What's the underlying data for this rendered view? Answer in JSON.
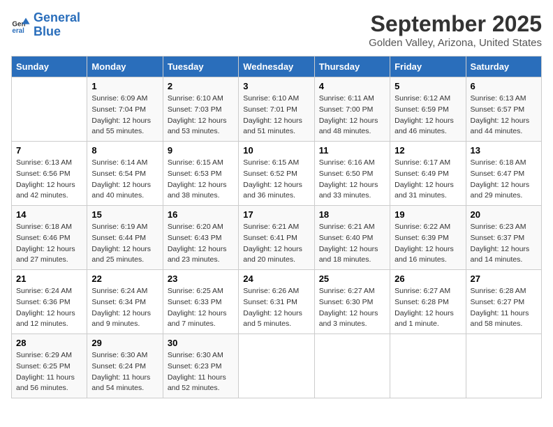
{
  "logo": {
    "line1": "General",
    "line2": "Blue"
  },
  "title": "September 2025",
  "location": "Golden Valley, Arizona, United States",
  "days_of_week": [
    "Sunday",
    "Monday",
    "Tuesday",
    "Wednesday",
    "Thursday",
    "Friday",
    "Saturday"
  ],
  "weeks": [
    [
      {
        "day": "",
        "info": ""
      },
      {
        "day": "1",
        "info": "Sunrise: 6:09 AM\nSunset: 7:04 PM\nDaylight: 12 hours\nand 55 minutes."
      },
      {
        "day": "2",
        "info": "Sunrise: 6:10 AM\nSunset: 7:03 PM\nDaylight: 12 hours\nand 53 minutes."
      },
      {
        "day": "3",
        "info": "Sunrise: 6:10 AM\nSunset: 7:01 PM\nDaylight: 12 hours\nand 51 minutes."
      },
      {
        "day": "4",
        "info": "Sunrise: 6:11 AM\nSunset: 7:00 PM\nDaylight: 12 hours\nand 48 minutes."
      },
      {
        "day": "5",
        "info": "Sunrise: 6:12 AM\nSunset: 6:59 PM\nDaylight: 12 hours\nand 46 minutes."
      },
      {
        "day": "6",
        "info": "Sunrise: 6:13 AM\nSunset: 6:57 PM\nDaylight: 12 hours\nand 44 minutes."
      }
    ],
    [
      {
        "day": "7",
        "info": "Sunrise: 6:13 AM\nSunset: 6:56 PM\nDaylight: 12 hours\nand 42 minutes."
      },
      {
        "day": "8",
        "info": "Sunrise: 6:14 AM\nSunset: 6:54 PM\nDaylight: 12 hours\nand 40 minutes."
      },
      {
        "day": "9",
        "info": "Sunrise: 6:15 AM\nSunset: 6:53 PM\nDaylight: 12 hours\nand 38 minutes."
      },
      {
        "day": "10",
        "info": "Sunrise: 6:15 AM\nSunset: 6:52 PM\nDaylight: 12 hours\nand 36 minutes."
      },
      {
        "day": "11",
        "info": "Sunrise: 6:16 AM\nSunset: 6:50 PM\nDaylight: 12 hours\nand 33 minutes."
      },
      {
        "day": "12",
        "info": "Sunrise: 6:17 AM\nSunset: 6:49 PM\nDaylight: 12 hours\nand 31 minutes."
      },
      {
        "day": "13",
        "info": "Sunrise: 6:18 AM\nSunset: 6:47 PM\nDaylight: 12 hours\nand 29 minutes."
      }
    ],
    [
      {
        "day": "14",
        "info": "Sunrise: 6:18 AM\nSunset: 6:46 PM\nDaylight: 12 hours\nand 27 minutes."
      },
      {
        "day": "15",
        "info": "Sunrise: 6:19 AM\nSunset: 6:44 PM\nDaylight: 12 hours\nand 25 minutes."
      },
      {
        "day": "16",
        "info": "Sunrise: 6:20 AM\nSunset: 6:43 PM\nDaylight: 12 hours\nand 23 minutes."
      },
      {
        "day": "17",
        "info": "Sunrise: 6:21 AM\nSunset: 6:41 PM\nDaylight: 12 hours\nand 20 minutes."
      },
      {
        "day": "18",
        "info": "Sunrise: 6:21 AM\nSunset: 6:40 PM\nDaylight: 12 hours\nand 18 minutes."
      },
      {
        "day": "19",
        "info": "Sunrise: 6:22 AM\nSunset: 6:39 PM\nDaylight: 12 hours\nand 16 minutes."
      },
      {
        "day": "20",
        "info": "Sunrise: 6:23 AM\nSunset: 6:37 PM\nDaylight: 12 hours\nand 14 minutes."
      }
    ],
    [
      {
        "day": "21",
        "info": "Sunrise: 6:24 AM\nSunset: 6:36 PM\nDaylight: 12 hours\nand 12 minutes."
      },
      {
        "day": "22",
        "info": "Sunrise: 6:24 AM\nSunset: 6:34 PM\nDaylight: 12 hours\nand 9 minutes."
      },
      {
        "day": "23",
        "info": "Sunrise: 6:25 AM\nSunset: 6:33 PM\nDaylight: 12 hours\nand 7 minutes."
      },
      {
        "day": "24",
        "info": "Sunrise: 6:26 AM\nSunset: 6:31 PM\nDaylight: 12 hours\nand 5 minutes."
      },
      {
        "day": "25",
        "info": "Sunrise: 6:27 AM\nSunset: 6:30 PM\nDaylight: 12 hours\nand 3 minutes."
      },
      {
        "day": "26",
        "info": "Sunrise: 6:27 AM\nSunset: 6:28 PM\nDaylight: 12 hours\nand 1 minute."
      },
      {
        "day": "27",
        "info": "Sunrise: 6:28 AM\nSunset: 6:27 PM\nDaylight: 11 hours\nand 58 minutes."
      }
    ],
    [
      {
        "day": "28",
        "info": "Sunrise: 6:29 AM\nSunset: 6:25 PM\nDaylight: 11 hours\nand 56 minutes."
      },
      {
        "day": "29",
        "info": "Sunrise: 6:30 AM\nSunset: 6:24 PM\nDaylight: 11 hours\nand 54 minutes."
      },
      {
        "day": "30",
        "info": "Sunrise: 6:30 AM\nSunset: 6:23 PM\nDaylight: 11 hours\nand 52 minutes."
      },
      {
        "day": "",
        "info": ""
      },
      {
        "day": "",
        "info": ""
      },
      {
        "day": "",
        "info": ""
      },
      {
        "day": "",
        "info": ""
      }
    ]
  ]
}
